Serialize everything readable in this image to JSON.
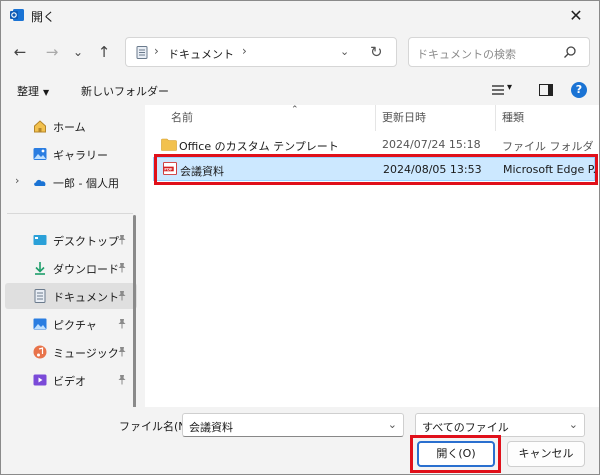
{
  "window": {
    "title": "開く",
    "close_glyph": "✕"
  },
  "nav": {
    "back_glyph": "←",
    "forward_glyph": "→",
    "recent_glyph": "⌄",
    "up_glyph": "↑",
    "breadcrumb_sep": "›",
    "address_text": "ドキュメント",
    "address_dropdown_glyph": "⌄",
    "refresh_glyph": "↻",
    "search_placeholder": "ドキュメントの検索"
  },
  "toolbar": {
    "organize_label": "整理",
    "organize_caret": "▼",
    "new_folder_label": "新しいフォルダー",
    "view_caret": "▾",
    "help_label": "?"
  },
  "sidebar": {
    "items": [
      {
        "label": "ホーム",
        "icon": "home-icon"
      },
      {
        "label": "ギャラリー",
        "icon": "gallery-icon"
      },
      {
        "label": "一郎 - 個人用",
        "icon": "onedrive-cloud-icon"
      },
      {
        "label": "デスクトップ",
        "icon": "desktop-icon",
        "pinned": true
      },
      {
        "label": "ダウンロード",
        "icon": "download-icon",
        "pinned": true
      },
      {
        "label": "ドキュメント",
        "icon": "documents-icon",
        "pinned": true,
        "selected": true
      },
      {
        "label": "ピクチャ",
        "icon": "pictures-icon",
        "pinned": true
      },
      {
        "label": "ミュージック",
        "icon": "music-icon",
        "pinned": true
      },
      {
        "label": "ビデオ",
        "icon": "videos-icon",
        "pinned": true
      }
    ],
    "expander_glyph": "›",
    "pin_glyph": "📌"
  },
  "files": {
    "columns": {
      "name": "名前",
      "modified": "更新日時",
      "type": "種類"
    },
    "sort_glyph": "⌃",
    "rows": [
      {
        "name": "Office のカスタム テンプレート",
        "modified": "2024/07/24 15:18",
        "type": "ファイル フォルダー",
        "icon": "folder-icon"
      },
      {
        "name": "会議資料",
        "modified": "2024/08/05 13:53",
        "type": "Microsoft Edge P...",
        "icon": "pdf-file-icon",
        "selected": true
      }
    ]
  },
  "footer": {
    "filename_label": "ファイル名(N):",
    "filename_value": "会議資料",
    "filetype_value": "すべてのファイル",
    "dropdown_glyph": "⌄",
    "open_label": "開く(O)",
    "cancel_label": "キャンセル"
  },
  "colors": {
    "accent": "#1a73d4",
    "selection": "#cce8ff",
    "highlight_frame": "#e0101a",
    "folder": "#f2c14e"
  }
}
